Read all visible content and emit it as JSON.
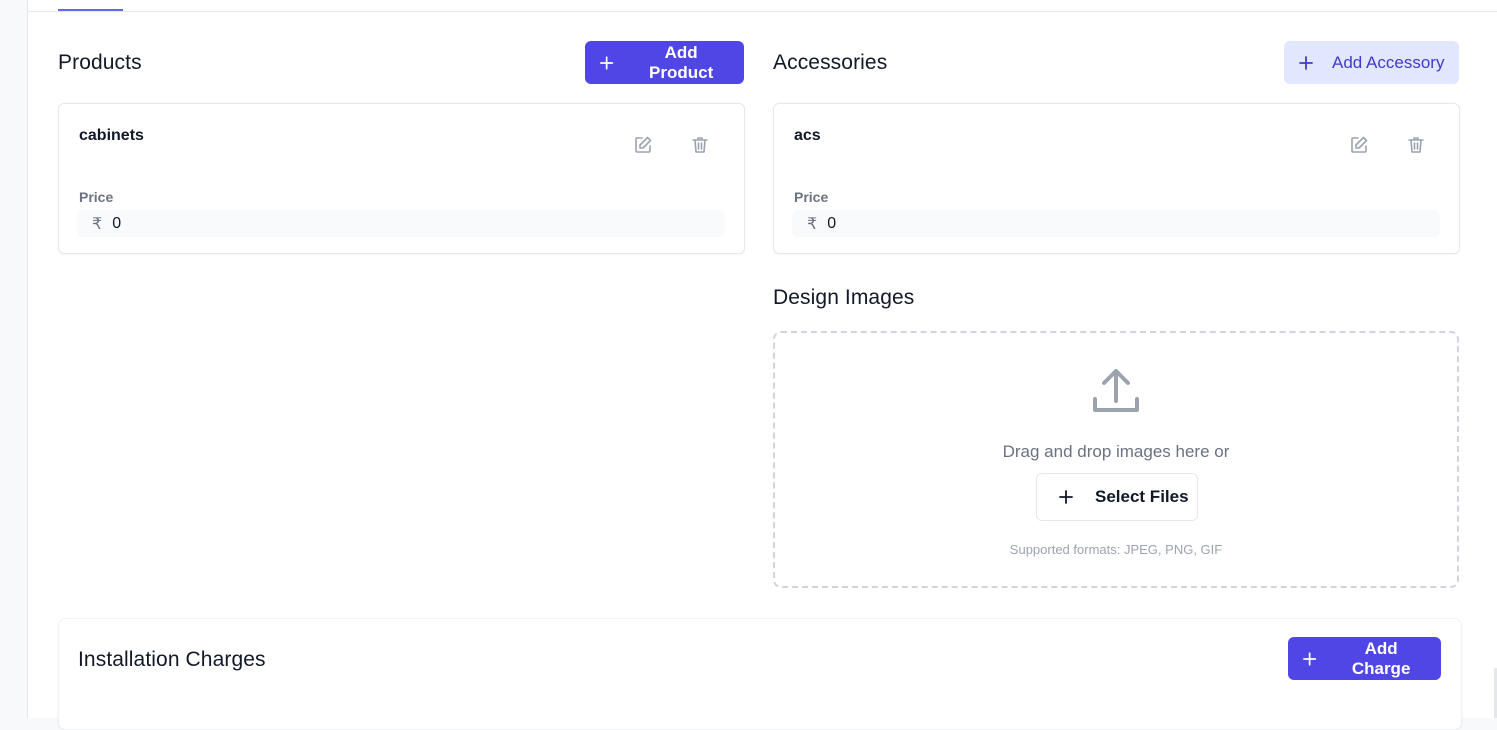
{
  "colors": {
    "accent": "#4f46e5",
    "accent_soft": "#e0e7ff",
    "icon_gray": "#9ca3af"
  },
  "products": {
    "title": "Products",
    "add_label": "Add Product",
    "items": [
      {
        "name": "cabinets",
        "price_label": "Price",
        "currency": "₹",
        "price": "0"
      }
    ]
  },
  "accessories": {
    "title": "Accessories",
    "add_label": "Add Accessory",
    "items": [
      {
        "name": "acs",
        "price_label": "Price",
        "currency": "₹",
        "price": "0"
      }
    ]
  },
  "design_images": {
    "title": "Design Images",
    "drop_text": "Drag and drop images here or",
    "select_label": "Select Files",
    "formats_text": "Supported formats: JPEG, PNG, GIF"
  },
  "installation": {
    "title": "Installation Charges",
    "add_label": "Add Charge"
  },
  "icons": {
    "plus": "plus-icon",
    "edit": "edit-icon",
    "delete": "trash-icon",
    "upload": "upload-icon"
  }
}
